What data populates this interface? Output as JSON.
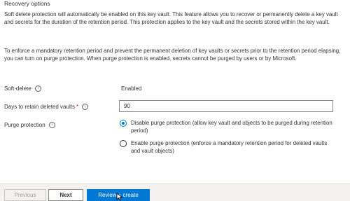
{
  "section_title": "Recovery options",
  "paragraph1": "Soft delete protection will automatically be enabled on this key vault. This feature allows you to recover or permanently delete a key vault and secrets for the duration of the retention period. This protection applies to the key vault and the secrets stored within the key vault.",
  "paragraph2": "To enforce a mandatory retention period and prevent the permanent deletion of key vaults or secrets prior to the retention period elapsing, you can turn on purge protection. When purge protection is enabled, secrets cannot be purged by users or by Microsoft.",
  "soft_delete": {
    "label": "Soft-delete",
    "value": "Enabled",
    "icon": "info-icon"
  },
  "retention_days": {
    "label": "Days to retain deleted vaults",
    "required_marker": "*",
    "value": "90",
    "icon": "info-icon"
  },
  "purge_protection": {
    "label": "Purge protection",
    "icon": "info-icon",
    "options": [
      {
        "label": "Disable purge protection (allow key vault and objects to be purged during retention period)",
        "selected": true
      },
      {
        "label": "Enable purge protection (enforce a mandatory retention period for deleted vaults and vault objects)",
        "selected": false
      }
    ]
  },
  "footer": {
    "previous_label": "Previous",
    "next_label": "Next",
    "review_label": "Review + create"
  },
  "colors": {
    "accent": "#0078d4",
    "required": "#a4262c",
    "footer_bg": "#f3f2f1"
  }
}
